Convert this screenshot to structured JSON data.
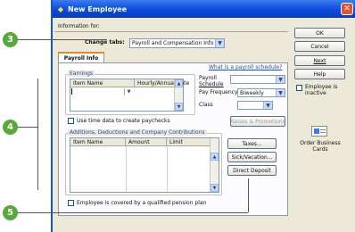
{
  "window": {
    "title": "New Employee",
    "close_glyph": "✕"
  },
  "callouts": [
    "3",
    "4",
    "5"
  ],
  "info_label": "Information for:",
  "change_tabs": {
    "label": "Change tabs:",
    "value": "Payroll and Compensation Info"
  },
  "tabs": [
    {
      "label": "Payroll Info"
    }
  ],
  "help_link": "What is a payroll schedule?",
  "earnings": {
    "title": "Earnings",
    "columns": [
      "Item Name",
      "Hourly/Annual Rate"
    ]
  },
  "payroll_schedule_label": [
    "Payroll",
    "Schedule"
  ],
  "pay_frequency": {
    "label": "Pay Frequency",
    "value": "Biweekly"
  },
  "class_label": "Class",
  "use_time_data": "Use time data to create paychecks",
  "raises_button": "Raises & Promotions",
  "adc": {
    "title": "Additions, Deductions and Company Contributions",
    "columns": [
      "Item Name",
      "Amount",
      "Limit"
    ]
  },
  "side_buttons": {
    "taxes": "Taxes...",
    "sick": "Sick/Vacation...",
    "direct_deposit": "Direct Deposit"
  },
  "pension_label": "Employee is covered by a qualified pension plan",
  "right_buttons": {
    "ok": "OK",
    "cancel": "Cancel",
    "next": "Next",
    "help": "Help"
  },
  "inactive_label": [
    "Employee is",
    "inactive"
  ],
  "order_cards": [
    "Order Business",
    "Cards"
  ],
  "colors": {
    "callout": "#58a83a",
    "titlebar": "#0b4bd8",
    "tab_accent": "#e68b2c",
    "close": "#e2542f"
  }
}
